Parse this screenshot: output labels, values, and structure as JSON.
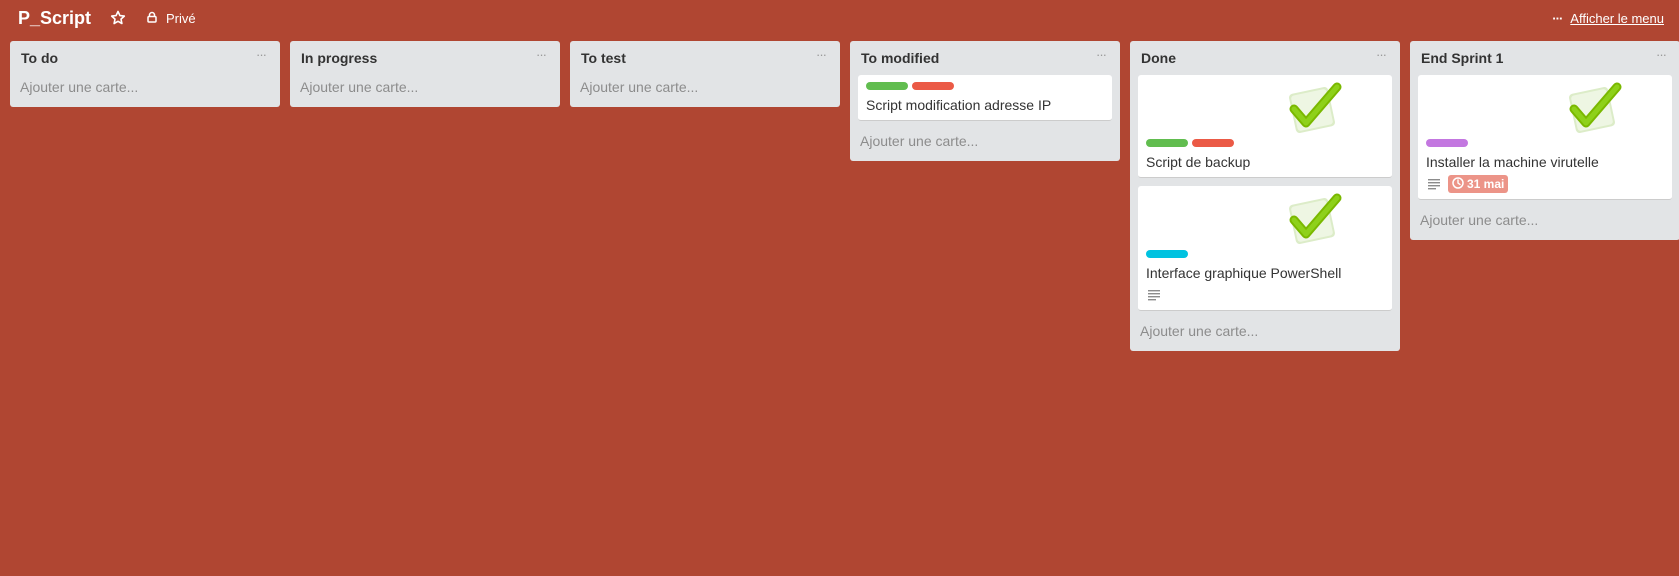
{
  "header": {
    "board_title": "P_Script",
    "privacy_label": "Privé",
    "show_menu_label": "Afficher le menu",
    "menu_dots": "···"
  },
  "colors": {
    "background": "#b04632",
    "label_green": "#61bd4f",
    "label_red": "#eb5a46",
    "label_sky": "#00c2e0",
    "label_purple": "#c377e0",
    "due_badge": "#ec9488"
  },
  "lists": [
    {
      "title": "To do",
      "menu": "···",
      "add_card": "Ajouter une carte...",
      "cards": []
    },
    {
      "title": "In progress",
      "menu": "···",
      "add_card": "Ajouter une carte...",
      "cards": []
    },
    {
      "title": "To test",
      "menu": "···",
      "add_card": "Ajouter une carte...",
      "cards": []
    },
    {
      "title": "To modified",
      "menu": "···",
      "add_card": "Ajouter une carte...",
      "cards": [
        {
          "title": "Script modification adresse IP",
          "labels": [
            "green",
            "red"
          ],
          "cover": false
        }
      ]
    },
    {
      "title": "Done",
      "menu": "···",
      "add_card": "Ajouter une carte...",
      "cards": [
        {
          "title": "Script de backup",
          "labels": [
            "green",
            "red"
          ],
          "cover": "checkmark-sticker"
        },
        {
          "title": "Interface graphique PowerShell",
          "labels": [
            "sky"
          ],
          "cover": "checkmark-sticker",
          "badges": [
            "description-icon"
          ]
        }
      ]
    },
    {
      "title": "End Sprint 1",
      "menu": "···",
      "add_card": "Ajouter une carte...",
      "cards": [
        {
          "title": "Installer la machine virutelle",
          "labels": [
            "purple"
          ],
          "cover": "checkmark-sticker",
          "badges": [
            "description-icon",
            "due-date"
          ],
          "due": "31 mai"
        }
      ]
    }
  ]
}
